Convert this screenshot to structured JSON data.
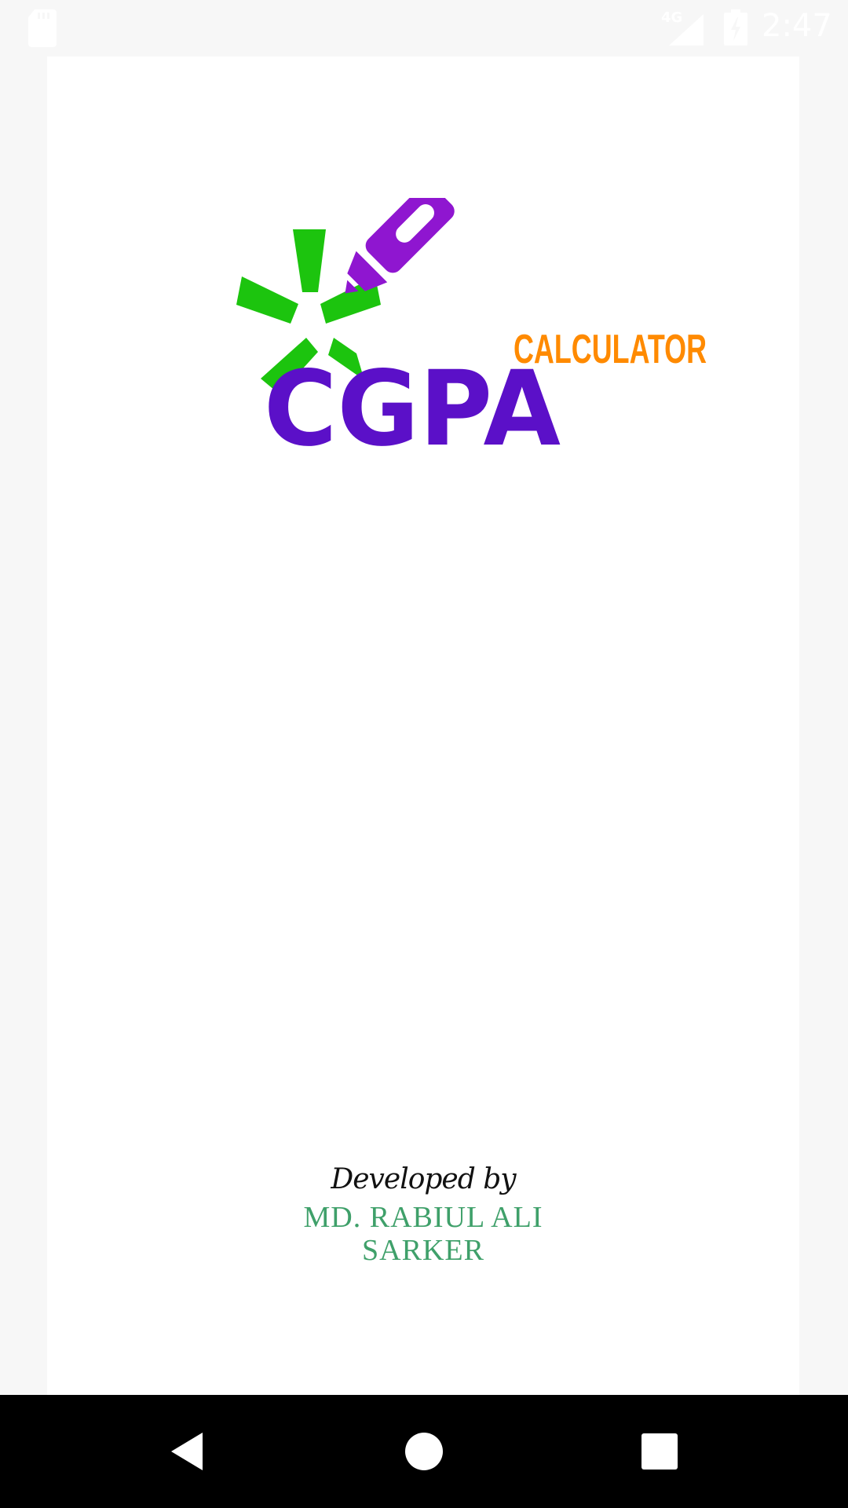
{
  "status_bar": {
    "network_type": "4G",
    "time": "2:47",
    "icons": [
      "sd-card-icon",
      "signal-icon",
      "battery-icon"
    ]
  },
  "logo": {
    "main_text": "CGPA",
    "sub_text": "CALCULATOR",
    "colors": {
      "main": "#5b10c8",
      "sub": "#ff8a00",
      "sparkle": "#1cc40e",
      "pen": "#8f16d0"
    }
  },
  "credits": {
    "developed_by": "Developed by",
    "developer_name": "MD. RABIUL ALI SARKER"
  },
  "nav_bar": {
    "buttons": [
      "back-icon",
      "home-icon",
      "recents-icon"
    ]
  },
  "colors": {
    "background": "#f7f7f7",
    "card": "#ffffff",
    "name": "#3fa06a"
  }
}
